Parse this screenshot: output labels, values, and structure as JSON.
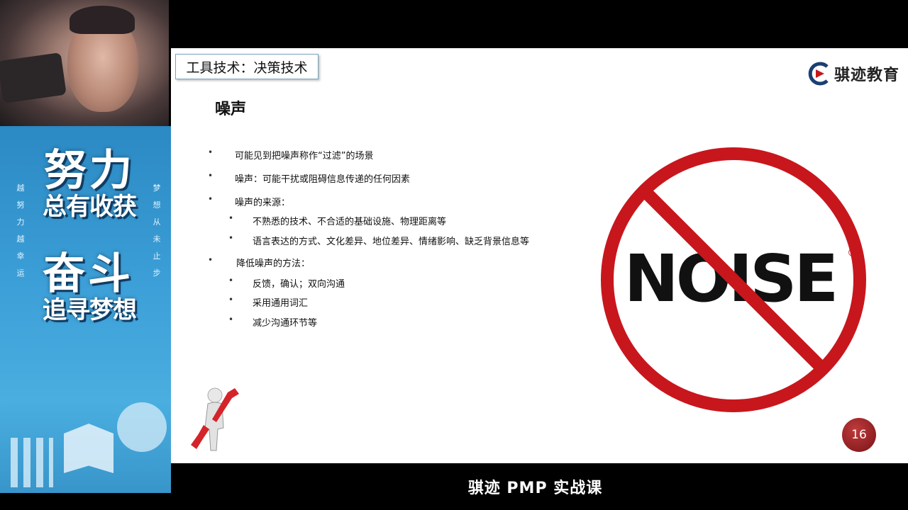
{
  "slide": {
    "tab_title": "工具技术：决策技术",
    "logo_text": "骐迹教育",
    "heading": "噪声",
    "bullets": [
      {
        "level": 1,
        "text": "可能见到把噪声称作“过滤”的场景"
      },
      {
        "level": 1,
        "text": "噪声：可能干扰或阻碍信息传递的任何因素"
      },
      {
        "level": 1,
        "text": "噪声的来源："
      },
      {
        "level": 2,
        "text": "不熟悉的技术、不合适的基础设施、物理距离等"
      },
      {
        "level": 2,
        "text": "语言表达的方式、文化差异、地位差异、情绪影响、缺乏背景信息等"
      },
      {
        "level": 1,
        "text": "降低噪声的方法："
      },
      {
        "level": 2,
        "text": "反馈，确认；双向沟通"
      },
      {
        "level": 2,
        "text": "采用通用词汇"
      },
      {
        "level": 2,
        "text": "减少沟通环节等"
      }
    ],
    "bullet_symbol": "•",
    "sign_text": "NOISE",
    "sign_mark": "®",
    "page_number": "16"
  },
  "banner": {
    "line1": "努力",
    "line2": "总有收获",
    "line3": "奋斗",
    "line4": "追寻梦想",
    "left_column": "越努力越幸运",
    "right_column": "梦想从未止步"
  },
  "footer": {
    "caption": "骐迹 PMP 实战课"
  },
  "colors": {
    "sign_red": "#c8161d",
    "banner_blue": "#3da0d8",
    "badge_red": "#8d1f22"
  }
}
